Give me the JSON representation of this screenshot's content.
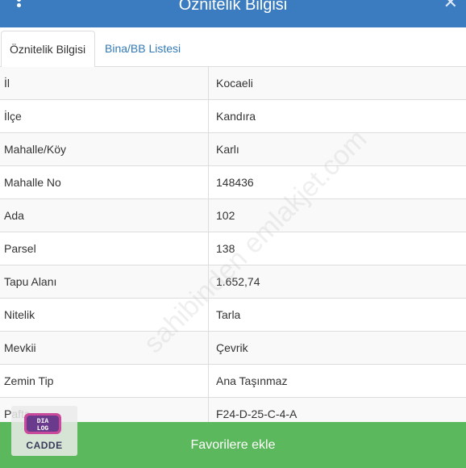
{
  "header": {
    "title": "Öznitelik Bilgisi"
  },
  "tabs": [
    {
      "label": "Öznitelik Bilgisi",
      "active": true
    },
    {
      "label": "Bina/BB Listesi",
      "active": false
    }
  ],
  "rows": [
    {
      "label": "İl",
      "value": "Kocaeli"
    },
    {
      "label": "İlçe",
      "value": "Kandıra"
    },
    {
      "label": "Mahalle/Köy",
      "value": "Karlı"
    },
    {
      "label": "Mahalle No",
      "value": "148436"
    },
    {
      "label": "Ada",
      "value": "102"
    },
    {
      "label": "Parsel",
      "value": "138"
    },
    {
      "label": "Tapu Alanı",
      "value": "1.652,74"
    },
    {
      "label": "Nitelik",
      "value": "Tarla"
    },
    {
      "label": "Mevkii",
      "value": "Çevrik"
    },
    {
      "label": "Zemin Tip",
      "value": "Ana Taşınmaz"
    },
    {
      "label": "Pafta",
      "value": "F24-D-25-C-4-A"
    }
  ],
  "footer": {
    "button_label": "Favorilere ekle"
  },
  "badge": {
    "logo_text": "DIA LOG",
    "label": "CADDE"
  },
  "watermark": {
    "text": "sahibinden emlakjet.com"
  },
  "colors": {
    "header": "#3a7cbf",
    "button": "#5cb85c",
    "tab_link": "#337ab7"
  }
}
